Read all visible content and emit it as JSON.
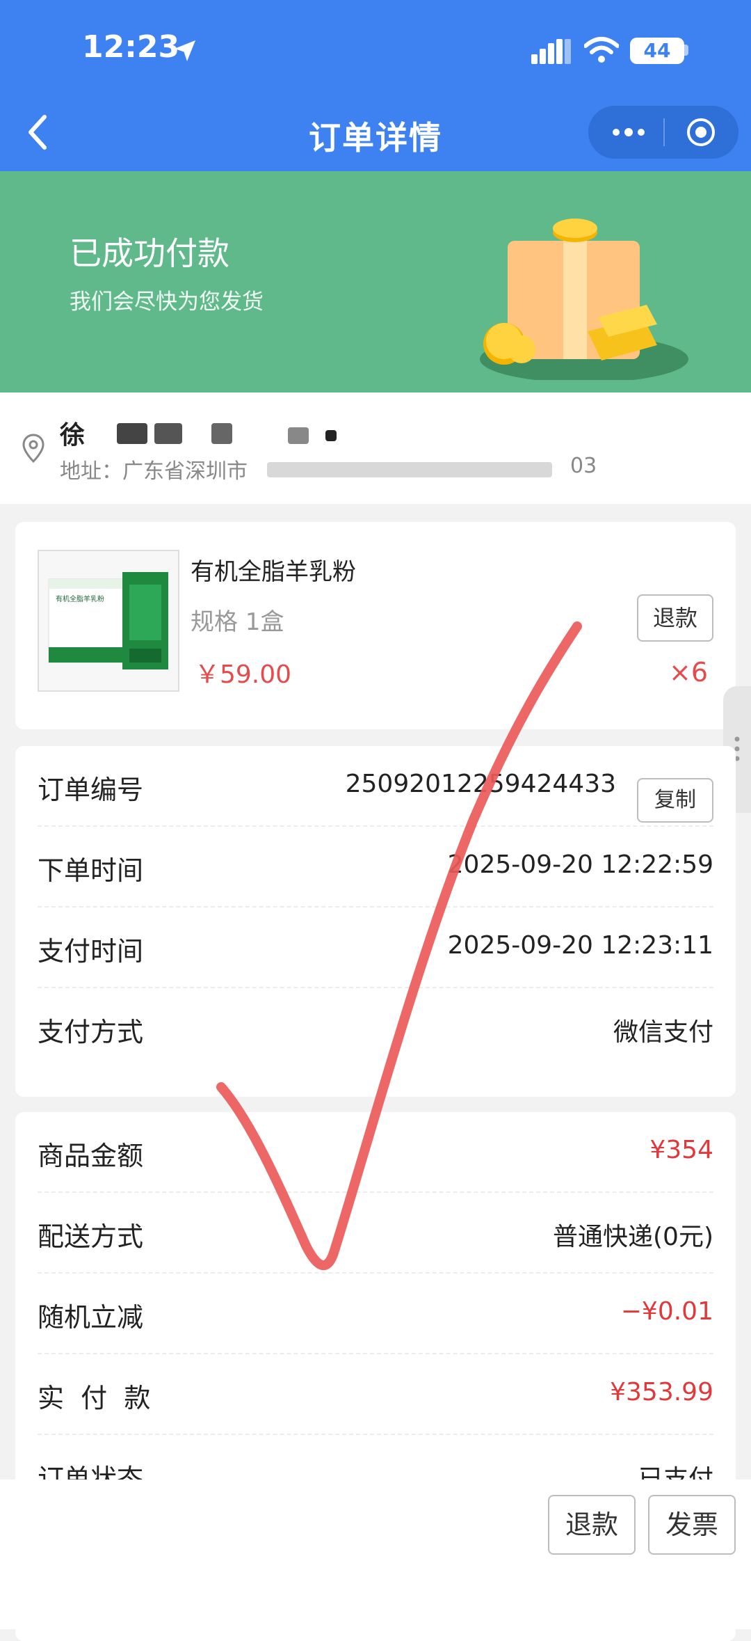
{
  "status_bar": {
    "time": "12:23",
    "battery": "44"
  },
  "nav": {
    "title": "订单详情"
  },
  "banner": {
    "title": "已成功付款",
    "subtitle": "我们会尽快为您发货"
  },
  "address": {
    "name": "徐",
    "address_prefix": "地址：广东省深圳市",
    "address_suffix": "03"
  },
  "product": {
    "name": "有机全脂羊乳粉",
    "spec": "规格 1盒",
    "price": "￥59.00",
    "quantity": "×6",
    "refund_label": "退款",
    "package_text": "有机全脂羊乳粉"
  },
  "order_info": {
    "rows": [
      {
        "label": "订单编号",
        "value": "25092012259424433"
      },
      {
        "label": "下单时间",
        "value": "2025-09-20 12:22:59"
      },
      {
        "label": "支付时间",
        "value": "2025-09-20 12:23:11"
      },
      {
        "label": "支付方式",
        "value": "微信支付"
      }
    ],
    "copy_label": "复制"
  },
  "amounts": {
    "rows": [
      {
        "label": "商品金额",
        "value": "¥354",
        "color": "#e0393b"
      },
      {
        "label": "配送方式",
        "value": "普通快递(0元)",
        "color": "#222222"
      },
      {
        "label": "随机立减",
        "value": "−¥0.01",
        "color": "#e0393b"
      },
      {
        "label": "实  付  款",
        "value": "¥353.99",
        "color": "#e0393b"
      },
      {
        "label": "订单状态",
        "value": "已支付",
        "color": "#222222"
      }
    ]
  },
  "bottom_bar": {
    "refund_label": "退款",
    "invoice_label": "发票"
  },
  "colors": {
    "nav_blue": "#3d82f0",
    "banner_green": "#5fb98a",
    "price_red": "#e54b4b",
    "check_red": "#ec5a5a"
  }
}
